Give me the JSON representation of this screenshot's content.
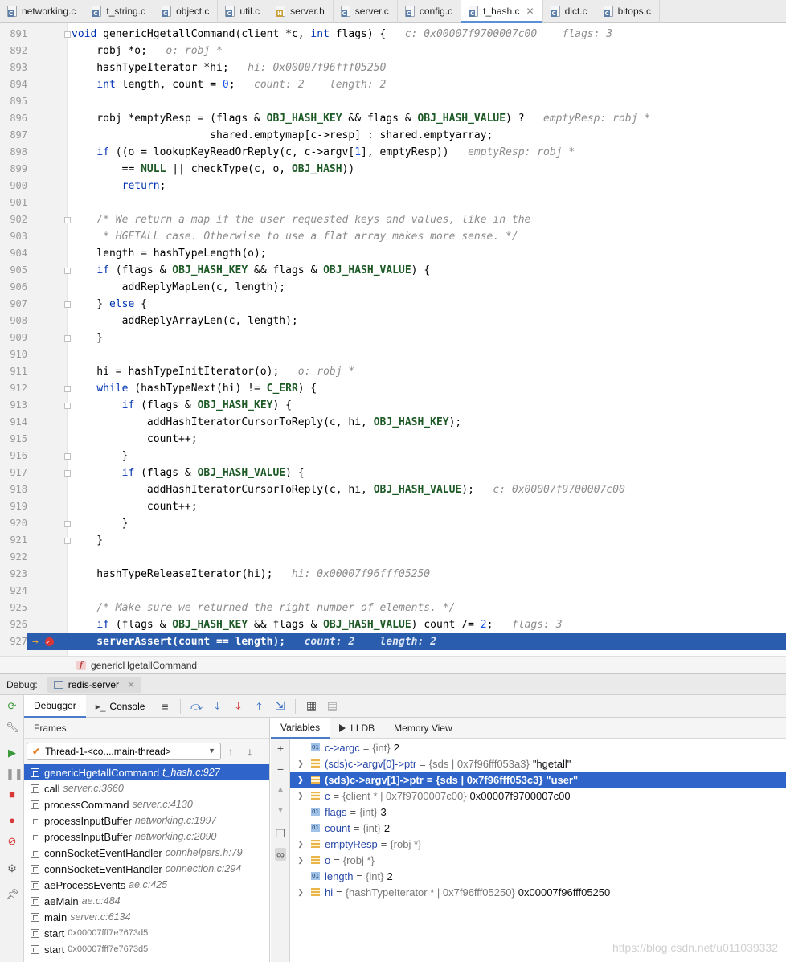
{
  "tabs": [
    {
      "label": "networking.c",
      "type": "c",
      "active": false
    },
    {
      "label": "t_string.c",
      "type": "c",
      "active": false
    },
    {
      "label": "object.c",
      "type": "c",
      "active": false
    },
    {
      "label": "util.c",
      "type": "c",
      "active": false
    },
    {
      "label": "server.h",
      "type": "h",
      "active": false
    },
    {
      "label": "server.c",
      "type": "c",
      "active": false
    },
    {
      "label": "config.c",
      "type": "c",
      "active": false
    },
    {
      "label": "t_hash.c",
      "type": "c",
      "active": true
    },
    {
      "label": "dict.c",
      "type": "c",
      "active": false
    },
    {
      "label": "bitops.c",
      "type": "c",
      "active": false
    }
  ],
  "editor": {
    "current_line": 927,
    "lines": [
      {
        "n": "891",
        "code": "<span class=\"kw\">void</span> genericHgetallCommand(client *c, <span class=\"kw\">int</span> flags) {",
        "hint": "c: 0x00007f9700007c00    flags: 3"
      },
      {
        "n": "892",
        "code": "    robj *o;",
        "hint": "o: robj *"
      },
      {
        "n": "893",
        "code": "    hashTypeIterator *hi;",
        "hint": "hi: 0x00007f96fff05250"
      },
      {
        "n": "894",
        "code": "    <span class=\"kw\">int</span> length, count = <span class=\"num\">0</span>;",
        "hint": "count: 2    length: 2"
      },
      {
        "n": "895",
        "code": "",
        "hint": ""
      },
      {
        "n": "896",
        "code": "    robj *emptyResp = (flags &amp; <span class=\"mac\">OBJ_HASH_KEY</span> &amp;&amp; flags &amp; <span class=\"mac\">OBJ_HASH_VALUE</span>) ?",
        "hint": "emptyResp: robj *"
      },
      {
        "n": "897",
        "code": "                      shared.emptymap[c-&gt;resp] : shared.emptyarray;",
        "hint": ""
      },
      {
        "n": "898",
        "code": "    <span class=\"kw\">if</span> ((o = lookupKeyReadOrReply(c, c-&gt;argv[<span class=\"num\">1</span>], emptyResp))",
        "hint": "emptyResp: robj *"
      },
      {
        "n": "899",
        "code": "        == <span class=\"mac\">NULL</span> || checkType(c, o, <span class=\"mac\">OBJ_HASH</span>))",
        "hint": ""
      },
      {
        "n": "900",
        "code": "        <span class=\"kw\">return</span>;",
        "hint": ""
      },
      {
        "n": "901",
        "code": "",
        "hint": ""
      },
      {
        "n": "902",
        "code": "    <span class=\"cm\">/* We return a map if the user requested keys and values, like in the</span>",
        "hint": ""
      },
      {
        "n": "903",
        "code": "<span class=\"cm\">     * HGETALL case. Otherwise to use a flat array makes more sense. */</span>",
        "hint": ""
      },
      {
        "n": "904",
        "code": "    length = hashTypeLength(o);",
        "hint": ""
      },
      {
        "n": "905",
        "code": "    <span class=\"kw\">if</span> (flags &amp; <span class=\"mac\">OBJ_HASH_KEY</span> &amp;&amp; flags &amp; <span class=\"mac\">OBJ_HASH_VALUE</span>) {",
        "hint": ""
      },
      {
        "n": "906",
        "code": "        addReplyMapLen(c, length);",
        "hint": ""
      },
      {
        "n": "907",
        "code": "    } <span class=\"kw\">else</span> {",
        "hint": ""
      },
      {
        "n": "908",
        "code": "        addReplyArrayLen(c, length);",
        "hint": ""
      },
      {
        "n": "909",
        "code": "    }",
        "hint": ""
      },
      {
        "n": "910",
        "code": "",
        "hint": ""
      },
      {
        "n": "911",
        "code": "    hi = hashTypeInitIterator(o);",
        "hint": "o: robj *"
      },
      {
        "n": "912",
        "code": "    <span class=\"kw\">while</span> (hashTypeNext(hi) != <span class=\"mac\">C_ERR</span>) {",
        "hint": ""
      },
      {
        "n": "913",
        "code": "        <span class=\"kw\">if</span> (flags &amp; <span class=\"mac\">OBJ_HASH_KEY</span>) {",
        "hint": ""
      },
      {
        "n": "914",
        "code": "            addHashIteratorCursorToReply(c, hi, <span class=\"mac\">OBJ_HASH_KEY</span>);",
        "hint": ""
      },
      {
        "n": "915",
        "code": "            count++;",
        "hint": ""
      },
      {
        "n": "916",
        "code": "        }",
        "hint": ""
      },
      {
        "n": "917",
        "code": "        <span class=\"kw\">if</span> (flags &amp; <span class=\"mac\">OBJ_HASH_VALUE</span>) {",
        "hint": ""
      },
      {
        "n": "918",
        "code": "            addHashIteratorCursorToReply(c, hi, <span class=\"mac\">OBJ_HASH_VALUE</span>);",
        "hint": "c: 0x00007f9700007c00"
      },
      {
        "n": "919",
        "code": "            count++;",
        "hint": ""
      },
      {
        "n": "920",
        "code": "        }",
        "hint": ""
      },
      {
        "n": "921",
        "code": "    }",
        "hint": ""
      },
      {
        "n": "922",
        "code": "",
        "hint": ""
      },
      {
        "n": "923",
        "code": "    hashTypeReleaseIterator(hi);",
        "hint": "hi: 0x00007f96fff05250"
      },
      {
        "n": "924",
        "code": "",
        "hint": ""
      },
      {
        "n": "925",
        "code": "    <span class=\"cm\">/* Make sure we returned the right number of elements. */</span>",
        "hint": ""
      },
      {
        "n": "926",
        "code": "    <span class=\"kw\">if</span> (flags &amp; <span class=\"mac\">OBJ_HASH_KEY</span> &amp;&amp; flags &amp; <span class=\"mac\">OBJ_HASH_VALUE</span>) count /= <span class=\"num\">2</span>;",
        "hint": "flags: 3"
      },
      {
        "n": "927",
        "code": "    serverAssert(count == length);",
        "hint": "count: 2    length: 2"
      }
    ]
  },
  "breadcrumb": {
    "function": "genericHgetallCommand",
    "badge": "f"
  },
  "debug": {
    "label": "Debug:",
    "session": "redis-server",
    "tabs": {
      "debugger": "Debugger",
      "console": "Console"
    },
    "frames_title": "Frames",
    "thread": "Thread-1-<co....main-thread>",
    "frames": [
      {
        "fn": "genericHgetallCommand",
        "loc": "t_hash.c:927",
        "selected": true
      },
      {
        "fn": "call",
        "loc": "server.c:3660"
      },
      {
        "fn": "processCommand",
        "loc": "server.c:4130"
      },
      {
        "fn": "processInputBuffer",
        "loc": "networking.c:1997"
      },
      {
        "fn": "processInputBuffer",
        "loc": "networking.c:2090"
      },
      {
        "fn": "connSocketEventHandler",
        "loc": "connhelpers.h:79"
      },
      {
        "fn": "connSocketEventHandler",
        "loc": "connection.c:294"
      },
      {
        "fn": "aeProcessEvents",
        "loc": "ae.c:425"
      },
      {
        "fn": "aeMain",
        "loc": "ae.c:484"
      },
      {
        "fn": "main",
        "loc": "server.c:6134"
      },
      {
        "fn": "start",
        "addr": "0x00007fff7e7673d5"
      },
      {
        "fn": "start",
        "addr": "0x00007fff7e7673d5"
      }
    ],
    "var_tabs": {
      "variables": "Variables",
      "lldb": "LLDB",
      "memory": "Memory View"
    },
    "variables": [
      {
        "name": "c->argc",
        "type": "{int}",
        "value": "2",
        "kind": "prim",
        "expand": false
      },
      {
        "name": "(sds)c->argv[0]->ptr",
        "type": "{sds | 0x7f96fff053a3}",
        "value": "\"hgetall\"",
        "kind": "struct",
        "expand": true
      },
      {
        "name": "(sds)c->argv[1]->ptr",
        "type": "{sds | 0x7f96fff053c3}",
        "value": "\"user\"",
        "kind": "struct",
        "expand": true,
        "selected": true
      },
      {
        "name": "c",
        "type": "{client * | 0x7f9700007c00}",
        "value": "0x00007f9700007c00",
        "kind": "struct",
        "expand": true
      },
      {
        "name": "flags",
        "type": "{int}",
        "value": "3",
        "kind": "prim",
        "expand": false
      },
      {
        "name": "count",
        "type": "{int}",
        "value": "2",
        "kind": "prim",
        "expand": false
      },
      {
        "name": "emptyResp",
        "type": "{robj *}",
        "value": "",
        "kind": "struct",
        "expand": true
      },
      {
        "name": "o",
        "type": "{robj *}",
        "value": "",
        "kind": "struct",
        "expand": true
      },
      {
        "name": "length",
        "type": "{int}",
        "value": "2",
        "kind": "prim",
        "expand": false
      },
      {
        "name": "hi",
        "type": "{hashTypeIterator * | 0x7f96fff05250}",
        "value": "0x00007f96fff05250",
        "kind": "struct",
        "expand": true
      }
    ]
  },
  "watermark": "https://blog.csdn.net/u011039332"
}
